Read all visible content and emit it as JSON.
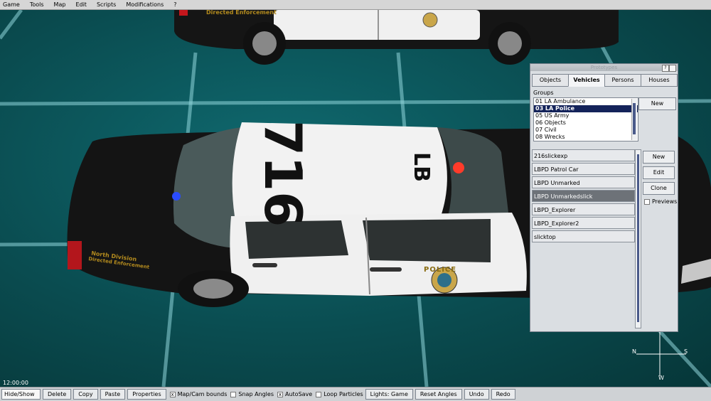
{
  "menubar": {
    "items": [
      "Game",
      "Tools",
      "Map",
      "Edit",
      "Scripts",
      "Modifications",
      "?"
    ]
  },
  "scene": {
    "roof_number": "716",
    "roof_letters": "LB",
    "decal_top": "Directed Enforcement",
    "decal_line1": "North Division",
    "decal_line2": "Directed Enforcement",
    "door_label": "POLICE",
    "clock": "12:00:00",
    "compass": {
      "n": "N",
      "s": "S",
      "w": "W"
    }
  },
  "panel": {
    "title": "Prototypes",
    "help_btn": "?",
    "close_btn": "",
    "tabs": [
      "Objects",
      "Vehicles",
      "Persons",
      "Houses"
    ],
    "active_tab": "Vehicles",
    "groups_label": "Groups",
    "groups": [
      "01 LA Ambulance",
      "03 LA Police",
      "05 US Army",
      "06 Objects",
      "07 Civil",
      "08 Wrecks"
    ],
    "selected_group": "03 LA Police",
    "group_new": "New",
    "prototypes": [
      "216slickexp",
      "LBPD Patrol Car",
      "LBPD Unmarked",
      "LBPD Unmarkedslick",
      "LBPD_Explorer",
      "LBPD_Explorer2",
      "slicktop"
    ],
    "selected_prototype": "LBPD Unmarkedslick",
    "proto_new": "New",
    "proto_edit": "Edit",
    "proto_clone": "Clone",
    "previews_label": "Previews"
  },
  "toolbar": {
    "hide_show": "Hide/Show",
    "delete": "Delete",
    "copy": "Copy",
    "paste": "Paste",
    "properties": "Properties",
    "map_cam_bounds": "Map/Cam bounds",
    "snap_angles": "Snap Angles",
    "autosave": "AutoSave",
    "loop_particles": "Loop Particles",
    "lights": "Lights: Game",
    "reset_angles": "Reset Angles",
    "undo": "Undo",
    "redo": "Redo",
    "checked_mark": "x"
  }
}
